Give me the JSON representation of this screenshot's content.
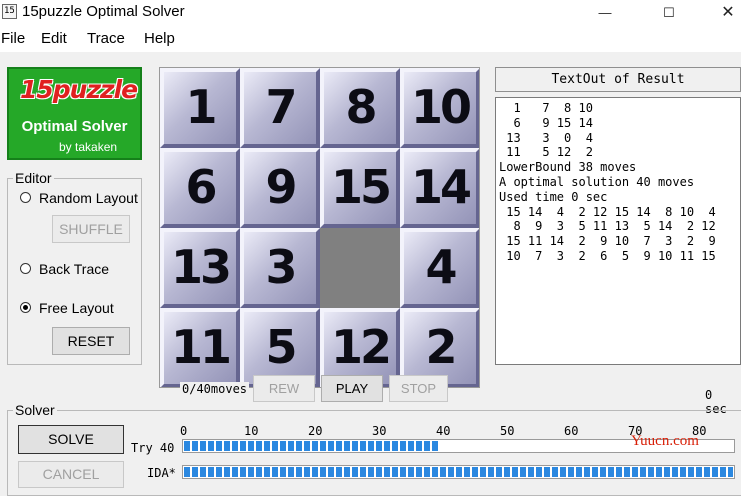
{
  "window": {
    "title": "15puzzle Optimal Solver",
    "icon_text": "15",
    "buttons": {
      "minimize": "—",
      "maximize": "☐",
      "close": "✕"
    }
  },
  "menu": [
    "File",
    "Edit",
    "Trace",
    "Help"
  ],
  "logo": {
    "title": "15puzzle",
    "subtitle": "Optimal Solver",
    "byline": "by takaken"
  },
  "editor": {
    "label": "Editor",
    "random_layout": "Random Layout",
    "shuffle": "SHUFFLE",
    "back_trace": "Back Trace",
    "free_layout": "Free Layout",
    "reset": "RESET",
    "selected": "free_layout"
  },
  "board": {
    "tiles": [
      "1",
      "7",
      "8",
      "10",
      "6",
      "9",
      "15",
      "14",
      "13",
      "3",
      "",
      "4",
      "11",
      "5",
      "12",
      "2"
    ]
  },
  "playback": {
    "moves_text": "0/40moves",
    "rew": "REW",
    "play": "PLAY",
    "stop": "STOP",
    "time_text": "0 sec"
  },
  "result": {
    "header": "TextOut of Result",
    "lines": [
      "  1   7  8 10",
      "  6   9 15 14",
      " 13   3  0  4",
      " 11   5 12  2",
      "LowerBound 38 moves",
      "A optimal solution 40 moves",
      "Used time 0 sec",
      " 15 14  4  2 12 15 14  8 10  4",
      "  8  9  3  5 11 13  5 14  2 12",
      " 15 11 14  2  9 10  7  3  2  9",
      " 10  7  3  2  6  5  9 10 11 15"
    ]
  },
  "solver": {
    "label": "Solver",
    "solve": "SOLVE",
    "cancel": "CANCEL",
    "try_label": "Try 40",
    "ida_label": "IDA*",
    "scale": [
      "0",
      "10",
      "20",
      "30",
      "40",
      "50",
      "60",
      "70",
      "80"
    ],
    "try_progress": 40,
    "ida_progress": 100,
    "watermark": "Yuucn.com"
  },
  "colors": {
    "logo_bg": "#25a828",
    "logo_title": "#e02020",
    "progress": "#2b88e0",
    "blank_tile": "#808080",
    "watermark": "#d81e06"
  }
}
